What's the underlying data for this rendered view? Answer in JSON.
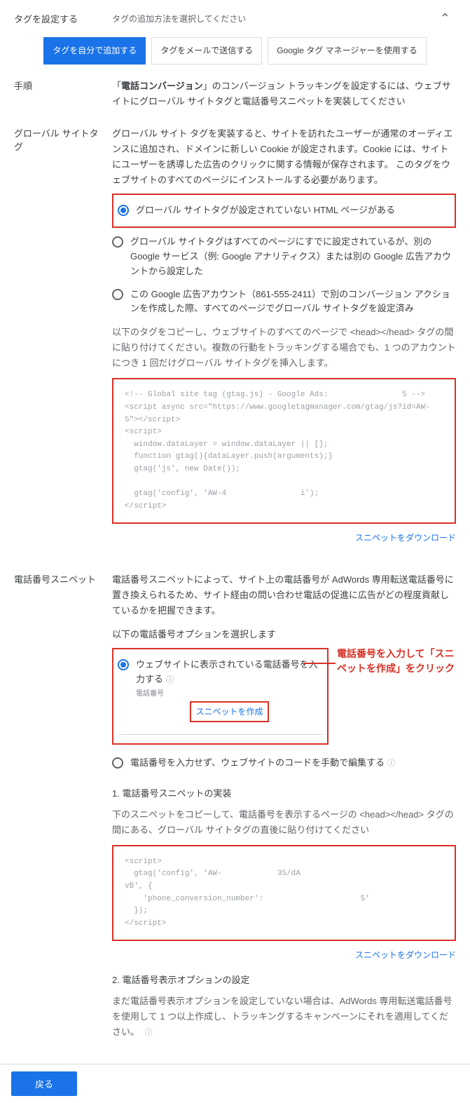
{
  "header": {
    "title": "タグを設定する",
    "subtitle": "タグの追加方法を選択してください"
  },
  "tabs": {
    "self": "タグを自分で追加する",
    "email": "タグをメールで送信する",
    "gtm": "Google タグ マネージャーを使用する"
  },
  "steps": {
    "label": "手順",
    "text_pre": "「",
    "text_bold": "電話コンバージョン",
    "text_post": "」のコンバージョン トラッキングを設定するには、ウェブサイトにグローバル サイトタグと電話番号スニペットを実装してください"
  },
  "gst": {
    "label": "グローバル サイトタグ",
    "intro": "グローバル サイト タグを実装すると、サイトを訪れたユーザーが通常のオーディエンスに追加され、ドメインに新しい Cookie が設定されます。Cookie には、サイトにユーザーを誘導した広告のクリックに関する情報が保存されます。 このタグをウェブサイトのすべてのページにインストールする必要があります。",
    "opt1": "グローバル サイトタグが設定されていない HTML ページがある",
    "opt2": "グローバル サイトタグはすべてのページにすでに設定されているが、別の Google サービス（例: Google アナリティクス）または別の Google 広告アカウントから設定した",
    "opt3": "この Google 広告アカウント（861-555-2411）で別のコンバージョン アクションを作成した際、すべてのページでグローバル サイトタグを設定済み",
    "below_note": "以下のタグをコピーし、ウェブサイトのすべてのページで <head></head> タグの間に貼り付けてください。複数の行動をトラッキングする場合でも、1 つのアカウントにつき 1 回だけグローバル サイトタグを挿入します。",
    "code": "<!-- Global site tag (gtag.js) - Google Ads:                5 -->\n<script async src=\"https://www.googletagmanager.com/gtag/js?id=AW-                5\"></script>\n<script>\n  window.dataLayer = window.dataLayer || [];\n  function gtag(){dataLayer.push(arguments);}\n  gtag('js', new Date());\n\n  gtag('config', 'AW-4                i');\n</script>",
    "dl": "スニペットをダウンロード"
  },
  "phone": {
    "label": "電話番号スニペット",
    "intro": "電話番号スニペットによって、サイト上の電話番号が AdWords 専用転送電話番号に置き換えられるため、サイト経由の問い合わせ電話の促進に広告がどの程度貢献しているかを把握できます。",
    "select_note": "以下の電話番号オプションを選択します",
    "opt1": "ウェブサイトに表示されている電話番号を入力する",
    "phone_label": "電話番号",
    "create_snippet": "スニペットを作成",
    "opt2": "電話番号を入力せず、ウェブサイトのコードを手動で編集する",
    "annotation": "電話番号を入力して「スニペットを作成」をクリック",
    "sec1_title": "1. 電話番号スニペットの実装",
    "sec1_note": "下のスニペットをコピーして、電話番号を表示するページの <head></head> タグの間にある、グローバル サイトタグの直後に貼り付けてください",
    "code": "<script>\n  gtag('config', 'AW-            35/dA                               vB', {\n    'phone_conversion_number':                     5'\n  });\n</script>",
    "dl": "スニペットをダウンロード",
    "sec2_title": "2. 電話番号表示オプションの設定",
    "sec2_note": "まだ電話番号表示オプションを設定していない場合は、AdWords 専用転送電話番号を使用して 1 つ以上作成し、トラッキングするキャンペーンにそれを適用してください。",
    "help": "⦿"
  },
  "footer": {
    "back": "戻る"
  }
}
